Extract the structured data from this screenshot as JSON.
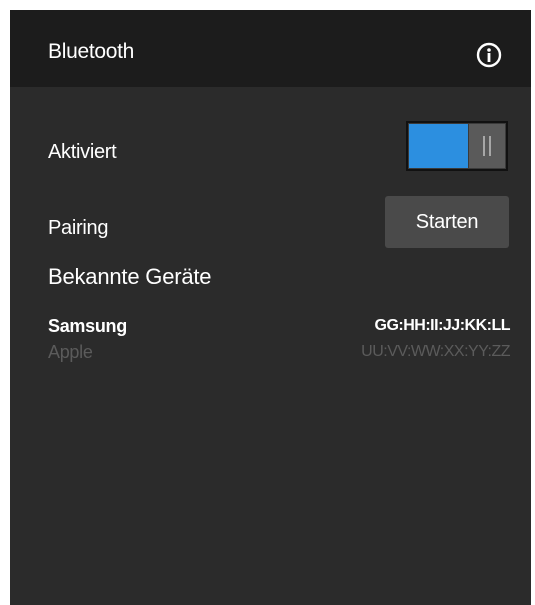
{
  "header": {
    "title": "Bluetooth",
    "info_icon": "info-circle-icon"
  },
  "settings": {
    "enabled_label": "Aktiviert",
    "enabled": true,
    "pairing_label": "Pairing",
    "pairing_button": "Starten"
  },
  "known_devices": {
    "title": "Bekannte Geräte",
    "devices": [
      {
        "name": "Samsung",
        "address": "GG:HH:II:JJ:KK:LL",
        "highlighted": true
      },
      {
        "name": "Apple",
        "address": "UU:VV:WW:XX:YY:ZZ",
        "highlighted": false
      }
    ]
  },
  "colors": {
    "panel_background": "#2b2b2b",
    "header_background": "#1c1c1c",
    "accent": "#2c8fe0",
    "button_background": "#4a4a4a",
    "dimmed_text": "#5b5b5b"
  }
}
